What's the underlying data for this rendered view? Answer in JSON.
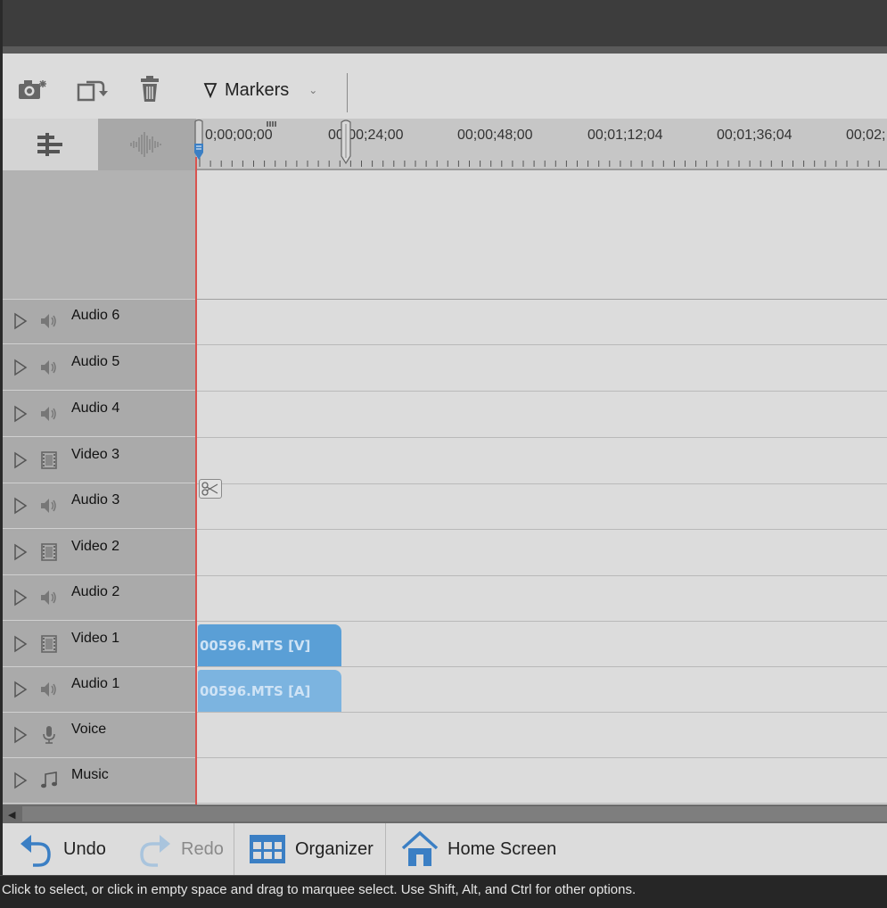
{
  "toolbar": {
    "markers_label": "Markers",
    "markers_icon": "marker-flag-icon",
    "icons": [
      "snapshot-camera-icon",
      "rotate-clip-icon",
      "trash-icon"
    ]
  },
  "view_tabs": {
    "icons": [
      "timeline-view-icon",
      "audio-waveform-icon"
    ],
    "active": "timeline-view"
  },
  "ruler": {
    "timecodes": [
      "0;00;00;00",
      "00;00;24;00",
      "00;00;48;00",
      "00;01;12;04",
      "00;01;36;04",
      "00;02;"
    ]
  },
  "tracks": [
    {
      "name": "Audio 6",
      "kind": "audio",
      "icon": "speaker-icon"
    },
    {
      "name": "Audio 5",
      "kind": "audio",
      "icon": "speaker-icon"
    },
    {
      "name": "Audio 4",
      "kind": "audio",
      "icon": "speaker-icon"
    },
    {
      "name": "Video 3",
      "kind": "video",
      "icon": "film-icon"
    },
    {
      "name": "Audio 3",
      "kind": "audio",
      "icon": "speaker-icon"
    },
    {
      "name": "Video 2",
      "kind": "video",
      "icon": "film-icon"
    },
    {
      "name": "Audio 2",
      "kind": "audio",
      "icon": "speaker-icon"
    },
    {
      "name": "Video 1",
      "kind": "video",
      "icon": "film-icon",
      "clip": "00596.MTS [V]"
    },
    {
      "name": "Audio 1",
      "kind": "audio",
      "icon": "speaker-icon",
      "clip": "00596.MTS [A]"
    },
    {
      "name": "Voice",
      "kind": "voice",
      "icon": "microphone-icon"
    },
    {
      "name": "Music",
      "kind": "music",
      "icon": "music-note-icon"
    }
  ],
  "bottom": {
    "undo": "Undo",
    "redo": "Redo",
    "organizer": "Organizer",
    "home": "Home Screen"
  },
  "status": {
    "text": "Click to select, or click in empty space and drag to marquee select. Use Shift, Alt, and Ctrl for other options."
  },
  "colors": {
    "video_clip": "#5a9fd6",
    "audio_clip": "#7cb4e0",
    "playhead_line": "#d9534f",
    "accent_blue": "#3b7fc4"
  }
}
